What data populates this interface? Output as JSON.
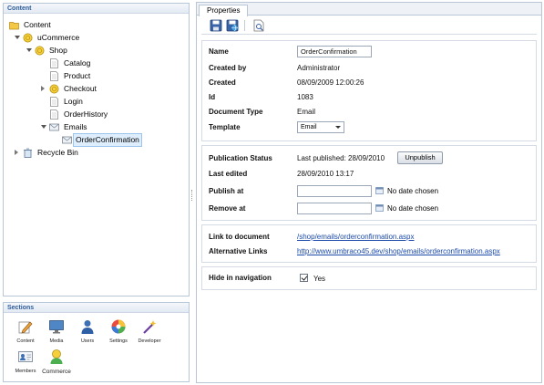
{
  "content_panel": {
    "title": "Content",
    "tree": [
      {
        "label": "Content",
        "depth": 0,
        "icon": "folder-icon",
        "twisty": "none"
      },
      {
        "label": "uCommerce",
        "depth": 1,
        "icon": "coin-icon",
        "twisty": "expanded"
      },
      {
        "label": "Shop",
        "depth": 2,
        "icon": "coin-icon",
        "twisty": "expanded"
      },
      {
        "label": "Catalog",
        "depth": 3,
        "icon": "page-icon",
        "twisty": "none"
      },
      {
        "label": "Product",
        "depth": 3,
        "icon": "page-icon",
        "twisty": "none"
      },
      {
        "label": "Checkout",
        "depth": 3,
        "icon": "coin-icon",
        "twisty": "collapsed"
      },
      {
        "label": "Login",
        "depth": 3,
        "icon": "page-icon",
        "twisty": "none"
      },
      {
        "label": "OrderHistory",
        "depth": 3,
        "icon": "page-icon",
        "twisty": "none"
      },
      {
        "label": "Emails",
        "depth": 3,
        "icon": "email-folder-icon",
        "twisty": "expanded"
      },
      {
        "label": "OrderConfirmation",
        "depth": 4,
        "icon": "email-icon",
        "twisty": "none",
        "selected": true
      },
      {
        "label": "Recycle Bin",
        "depth": 0,
        "icon": "recycle-bin-icon",
        "twisty": "collapsed"
      }
    ]
  },
  "sections_panel": {
    "title": "Sections",
    "items": [
      {
        "label": "Content",
        "icon": "pencil-icon"
      },
      {
        "label": "Media",
        "icon": "monitor-icon"
      },
      {
        "label": "Users",
        "icon": "user-icon"
      },
      {
        "label": "Settings",
        "icon": "color-wheel-icon"
      },
      {
        "label": "Developer",
        "icon": "magic-wand-icon"
      },
      {
        "label": "Members",
        "icon": "members-card-icon"
      },
      {
        "label": "Commerce",
        "icon": "commerce-icon"
      }
    ]
  },
  "properties": {
    "tab_label": "Properties",
    "toolbar": {
      "save_icon": "save-icon",
      "save_publish_icon": "save-publish-icon",
      "preview_icon": "preview-icon"
    },
    "general": {
      "name_label": "Name",
      "name_value": "OrderConfirmation",
      "created_by_label": "Created by",
      "created_by_value": "Administrator",
      "created_label": "Created",
      "created_value": "08/09/2009 12:00:26",
      "id_label": "Id",
      "id_value": "1083",
      "doctype_label": "Document Type",
      "doctype_value": "Email",
      "template_label": "Template",
      "template_value": "Email"
    },
    "publication": {
      "status_label": "Publication Status",
      "status_value": "Last published: 28/09/2010",
      "unpublish_label": "Unpublish",
      "last_edited_label": "Last edited",
      "last_edited_value": "28/09/2010 13:17",
      "publish_at_label": "Publish at",
      "publish_at_value": "",
      "publish_at_hint": "No date chosen",
      "remove_at_label": "Remove at",
      "remove_at_value": "",
      "remove_at_hint": "No date chosen"
    },
    "links": {
      "link_label": "Link to document",
      "link_value": "/shop/emails/orderconfirmation.aspx",
      "alt_label": "Alternative Links",
      "alt_value": "http://www.umbraco45.dev/shop/emails/orderconfirmation.aspx"
    },
    "navigation": {
      "hide_label": "Hide in navigation",
      "hide_checked": true,
      "hide_value": "Yes"
    }
  },
  "colors": {
    "panel_border": "#b9c6d6",
    "title_text": "#2d5b9a",
    "link": "#1b4aa8",
    "selection_bg": "#dfeefd"
  }
}
